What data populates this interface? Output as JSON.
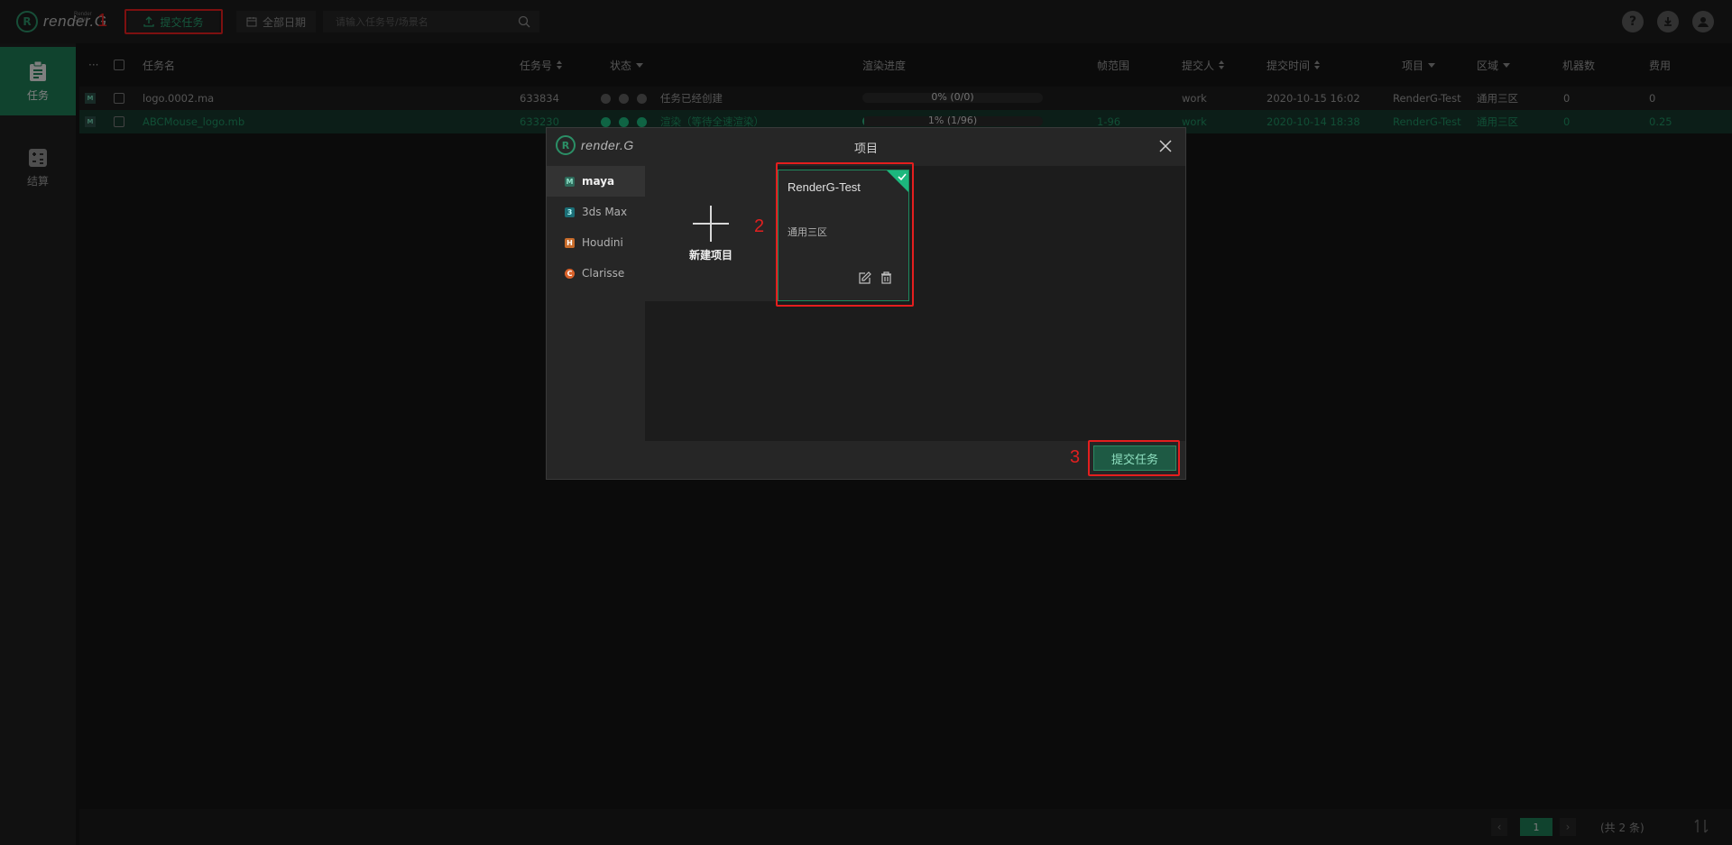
{
  "app": {
    "logo_text": "render.G",
    "logo_letter": "R",
    "logo_tag": "Render Cloud"
  },
  "toolbar": {
    "submit_label": "提交任务",
    "date_label": "全部日期",
    "search_placeholder": "请输入任务号/场景名",
    "annotation_1": "1"
  },
  "sidebar": {
    "items": [
      {
        "label": "任务",
        "icon": "clipboard-icon",
        "active": true
      },
      {
        "label": "结算",
        "icon": "billing-icon",
        "active": false
      }
    ]
  },
  "table": {
    "more": "···",
    "headers": {
      "name": "任务名",
      "id": "任务号",
      "status": "状态",
      "progress": "渲染进度",
      "frames": "帧范围",
      "submitter": "提交人",
      "time": "提交时间",
      "project": "项目",
      "zone": "区域",
      "machines": "机器数",
      "cost": "费用"
    },
    "rows": [
      {
        "software": "M",
        "name": "logo.0002.ma",
        "id": "633834",
        "status": "任务已经创建",
        "progress_label": "0% (0/0)",
        "progress": 0,
        "frames": "",
        "submitter": "work",
        "time": "2020-10-15 16:02",
        "project": "RenderG-Test",
        "zone": "通用三区",
        "machines": "0",
        "cost": "0"
      },
      {
        "software": "M",
        "name": "ABCMouse_logo.mb",
        "id": "633230",
        "status": "渲染（等待全速渲染）",
        "progress_label": "1% (1/96)",
        "progress": 0.01,
        "frames": "1-96",
        "submitter": "work",
        "time": "2020-10-14 18:38",
        "project": "RenderG-Test",
        "zone": "通用三区",
        "machines": "0",
        "cost": "0.25"
      }
    ]
  },
  "pagination": {
    "current": "1",
    "prev": "‹",
    "next": "›",
    "total": "(共 2 条)"
  },
  "dialog": {
    "title": "项目",
    "software": [
      {
        "label": "maya",
        "icon": "M",
        "color": "#2e6b5b",
        "active": true
      },
      {
        "label": "3ds Max",
        "icon": "3",
        "color": "#1b6e76",
        "active": false
      },
      {
        "label": "Houdini",
        "icon": "H",
        "color": "#c76b2a",
        "active": false
      },
      {
        "label": "Clarisse",
        "icon": "C",
        "color": "#d9622a",
        "active": false
      }
    ],
    "new_project_label": "新建项目",
    "project_card": {
      "title": "RenderG-Test",
      "zone": "通用三区"
    },
    "submit_label": "提交任务",
    "annotation_2": "2",
    "annotation_3": "3"
  },
  "colors": {
    "accent": "#1e7a55",
    "highlight": "#1cb77d",
    "annotation": "#e41e1e"
  }
}
